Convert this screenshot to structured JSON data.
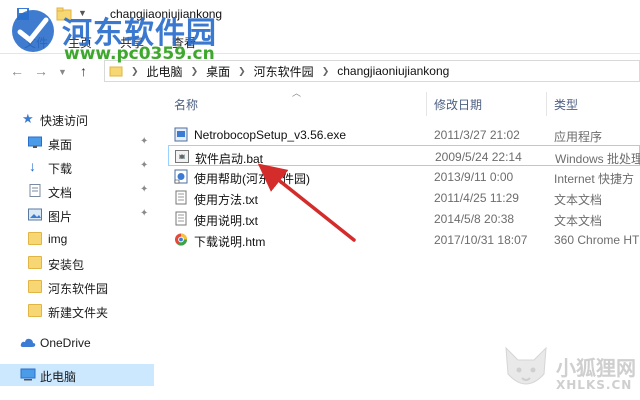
{
  "window": {
    "title": "changjiaoniujiankong"
  },
  "ribbon": {
    "tabs": [
      "文件",
      "主页",
      "共享",
      "查看"
    ]
  },
  "watermark": {
    "site_name": "河东软件园",
    "site_url": "www.pc0359.cn",
    "corner_name": "小狐狸网",
    "corner_url": "XHLKS.CN"
  },
  "address": {
    "crumbs": [
      "此电脑",
      "桌面",
      "河东软件园",
      "changjiaoniujiankong"
    ]
  },
  "nav": {
    "items": [
      {
        "label": "快速访问",
        "icon": "star-icon",
        "pinned": false
      },
      {
        "label": "桌面",
        "icon": "desktop-icon",
        "pinned": true
      },
      {
        "label": "下载",
        "icon": "download-icon",
        "pinned": true
      },
      {
        "label": "文档",
        "icon": "document-icon",
        "pinned": true
      },
      {
        "label": "图片",
        "icon": "picture-icon",
        "pinned": true
      },
      {
        "label": "img",
        "icon": "folder-icon",
        "pinned": false
      },
      {
        "label": "安装包",
        "icon": "folder-icon",
        "pinned": false
      },
      {
        "label": "河东软件园",
        "icon": "folder-icon",
        "pinned": false
      },
      {
        "label": "新建文件夹",
        "icon": "folder-icon",
        "pinned": false
      },
      {
        "label": "OneDrive",
        "icon": "cloud-icon",
        "pinned": false
      },
      {
        "label": "此电脑",
        "icon": "computer-icon",
        "pinned": false
      }
    ],
    "pin_glyph": "📌"
  },
  "columns": {
    "name": "名称",
    "date": "修改日期",
    "type": "类型"
  },
  "files": [
    {
      "name": "NetrobocopSetup_v3.56.exe",
      "date": "2011/3/27 21:02",
      "type": "应用程序",
      "icon": "exe-icon"
    },
    {
      "name": "软件启动.bat",
      "date": "2009/5/24 22:14",
      "type": "Windows 批处理",
      "icon": "bat-icon"
    },
    {
      "name": "使用帮助(河东软件园)",
      "date": "2013/9/11 0:00",
      "type": "Internet 快捷方",
      "icon": "shortcut-icon"
    },
    {
      "name": "使用方法.txt",
      "date": "2011/4/25 11:29",
      "type": "文本文档",
      "icon": "txt-icon"
    },
    {
      "name": "使用说明.txt",
      "date": "2014/5/8 20:38",
      "type": "文本文档",
      "icon": "txt-icon"
    },
    {
      "name": "下载说明.htm",
      "date": "2017/10/31 18:07",
      "type": "360 Chrome HT",
      "icon": "htm-icon"
    }
  ],
  "colors": {
    "selection": "#cce8ff",
    "highlight_border": "#99d1ff",
    "annotation_arrow": "#d42b2b"
  }
}
